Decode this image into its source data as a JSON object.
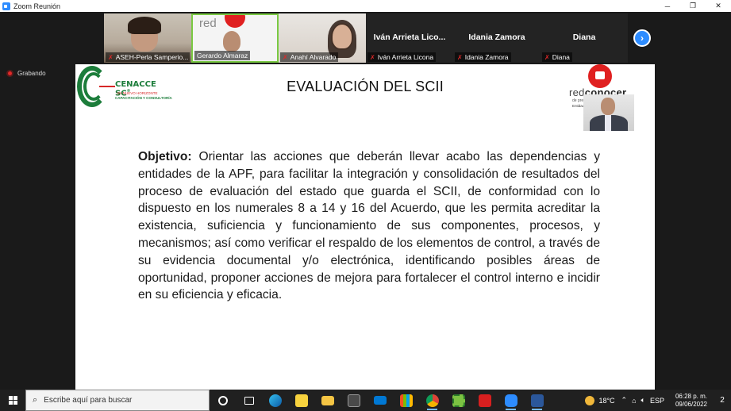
{
  "window": {
    "title": "Zoom Reunión",
    "minimize": "─",
    "restore": "❐",
    "close": "✕"
  },
  "recording": {
    "label": "Grabando"
  },
  "participants": [
    {
      "name": "ASEH-Perla Samperio...",
      "muted": true
    },
    {
      "name": "Gerardo Almaraz",
      "muted": false
    },
    {
      "name": "Anahí Alvarado",
      "muted": true
    },
    {
      "name": "Iván Arrieta Licona",
      "display_name": "Iván Arrieta Lico...",
      "muted": true
    },
    {
      "name": "Idania Zamora",
      "display_name": "Idania Zamora",
      "muted": true
    },
    {
      "name": "Diana",
      "display_name": "Diana",
      "muted": true
    }
  ],
  "slide": {
    "title": "EVALUACIÓN DEL SCII",
    "logo_left": {
      "brand": "CENACCE SC",
      "registered": "®",
      "tagline1": "UN NUEVO HORIZONTE",
      "tagline2": "CAPACITACIÓN Y CONSULTORÍA"
    },
    "logo_right": {
      "word_a": "red",
      "word_b": "conocer",
      "tagline1": "de prestadores de servicios",
      "tagline2": "Entidad de Certificación y Evaluación"
    },
    "objective_label": "Objetivo:",
    "objective_text": " Orientar las acciones que deberán llevar acabo las dependencias y entidades de la APF, para facilitar la integración y consolidación de resultados del proceso de evaluación del estado que guarda el SCII, de conformidad con lo dispuesto en los numerales 8 a 14 y 16 del Acuerdo, que les permita acreditar la existencia, suficiencia y funcionamiento de sus componentes, procesos, y mecanismos; así como verificar el respaldo de los elementos de control, a través de su evidencia documental y/o electrónica, identificando posibles áreas de oportunidad, proponer acciones de mejora para fortalecer el control interno e incidir en su eficiencia y eficacia."
  },
  "taskbar": {
    "search_placeholder": "Escribe aquí para buscar",
    "apps": [
      "cortana",
      "task-view",
      "edge",
      "sticky-notes",
      "file-explorer",
      "calculator",
      "mail",
      "store",
      "chrome",
      "excel-app",
      "acrobat",
      "zoom",
      "word"
    ],
    "temperature": "18°C",
    "language": "ESP",
    "time": "06:28 p. m.",
    "date": "09/06/2022",
    "notifications": "2"
  }
}
